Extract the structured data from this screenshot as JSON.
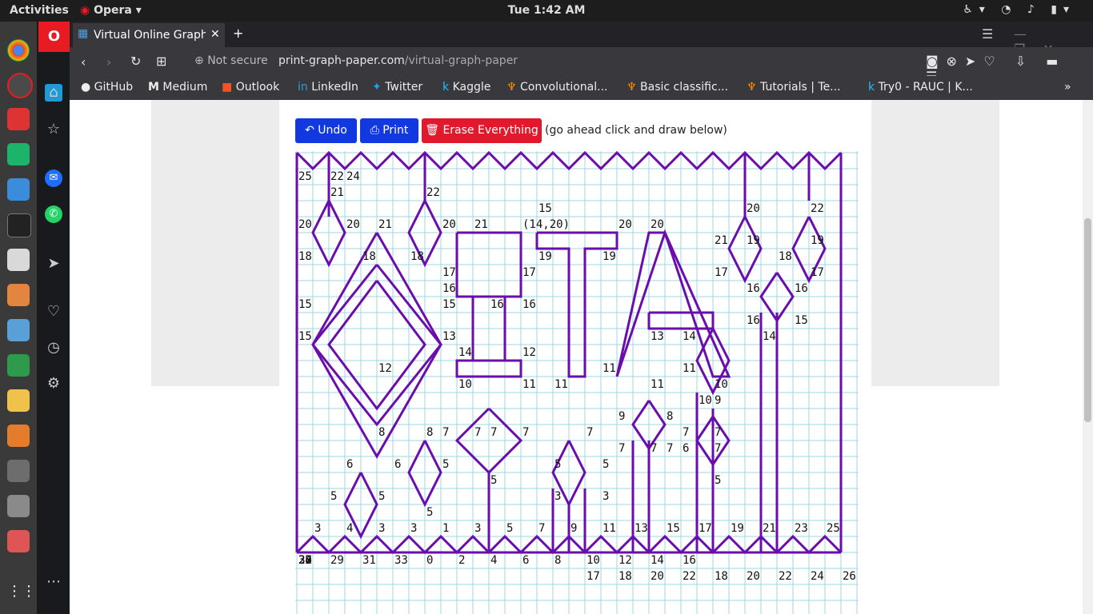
{
  "system": {
    "activities": "Activities",
    "app_menu": "Opera",
    "clock": "Tue  1:42 AM"
  },
  "browser": {
    "tab_title": "Virtual Online Graph",
    "security": "Not secure",
    "url_host": "print-graph-paper.com",
    "url_path": "/virtual-graph-paper",
    "bookmarks": [
      "GitHub",
      "Medium",
      "Outlook",
      "LinkedIn",
      "Twitter",
      "Kaggle",
      "Convolutional...",
      "Basic classific...",
      "Tutorials | Te...",
      "Try0 - RAUC | K..."
    ]
  },
  "toolbar": {
    "undo_label": "Undo",
    "print_label": "Print",
    "erase_label": "Erase Everything",
    "hint": "(go ahead click and draw below)"
  },
  "canvas": {
    "color_grid": "#9fd6e3",
    "color_drawing": "#6a0dad",
    "labels": [
      "25",
      "22",
      "24",
      "21",
      "22",
      "15",
      "(14,20)",
      "20",
      "20",
      "20",
      "20",
      "21",
      "20",
      "20",
      "22",
      "21",
      "21",
      "19",
      "19",
      "19",
      "19",
      "18",
      "18",
      "18",
      "18",
      "17",
      "17",
      "17",
      "17",
      "16",
      "16",
      "16",
      "16",
      "15",
      "15",
      "16",
      "16",
      "15",
      "15",
      "13",
      "13",
      "14",
      "14",
      "14",
      "12",
      "12",
      "10",
      "11",
      "11",
      "11",
      "11",
      "11",
      "10",
      "9",
      "10",
      "9",
      "8",
      "8",
      "8",
      "7",
      "7",
      "7",
      "7",
      "7",
      "7",
      "7",
      "7",
      "7",
      "6",
      "7",
      "7",
      "6",
      "6",
      "5",
      "5",
      "5",
      "5",
      "5",
      "5",
      "5",
      "5",
      "3",
      "3",
      "3",
      "4",
      "3",
      "3",
      "1",
      "3",
      "5",
      "7",
      "9",
      "11",
      "13",
      "15",
      "17",
      "19",
      "21",
      "23",
      "25",
      "27",
      "29",
      "31",
      "33",
      "0",
      "2",
      "4",
      "6",
      "8",
      "10",
      "12",
      "14",
      "16",
      "17",
      "18",
      "20",
      "22",
      "18",
      "20",
      "22",
      "24",
      "26",
      "28",
      "30",
      "32",
      "34"
    ]
  }
}
